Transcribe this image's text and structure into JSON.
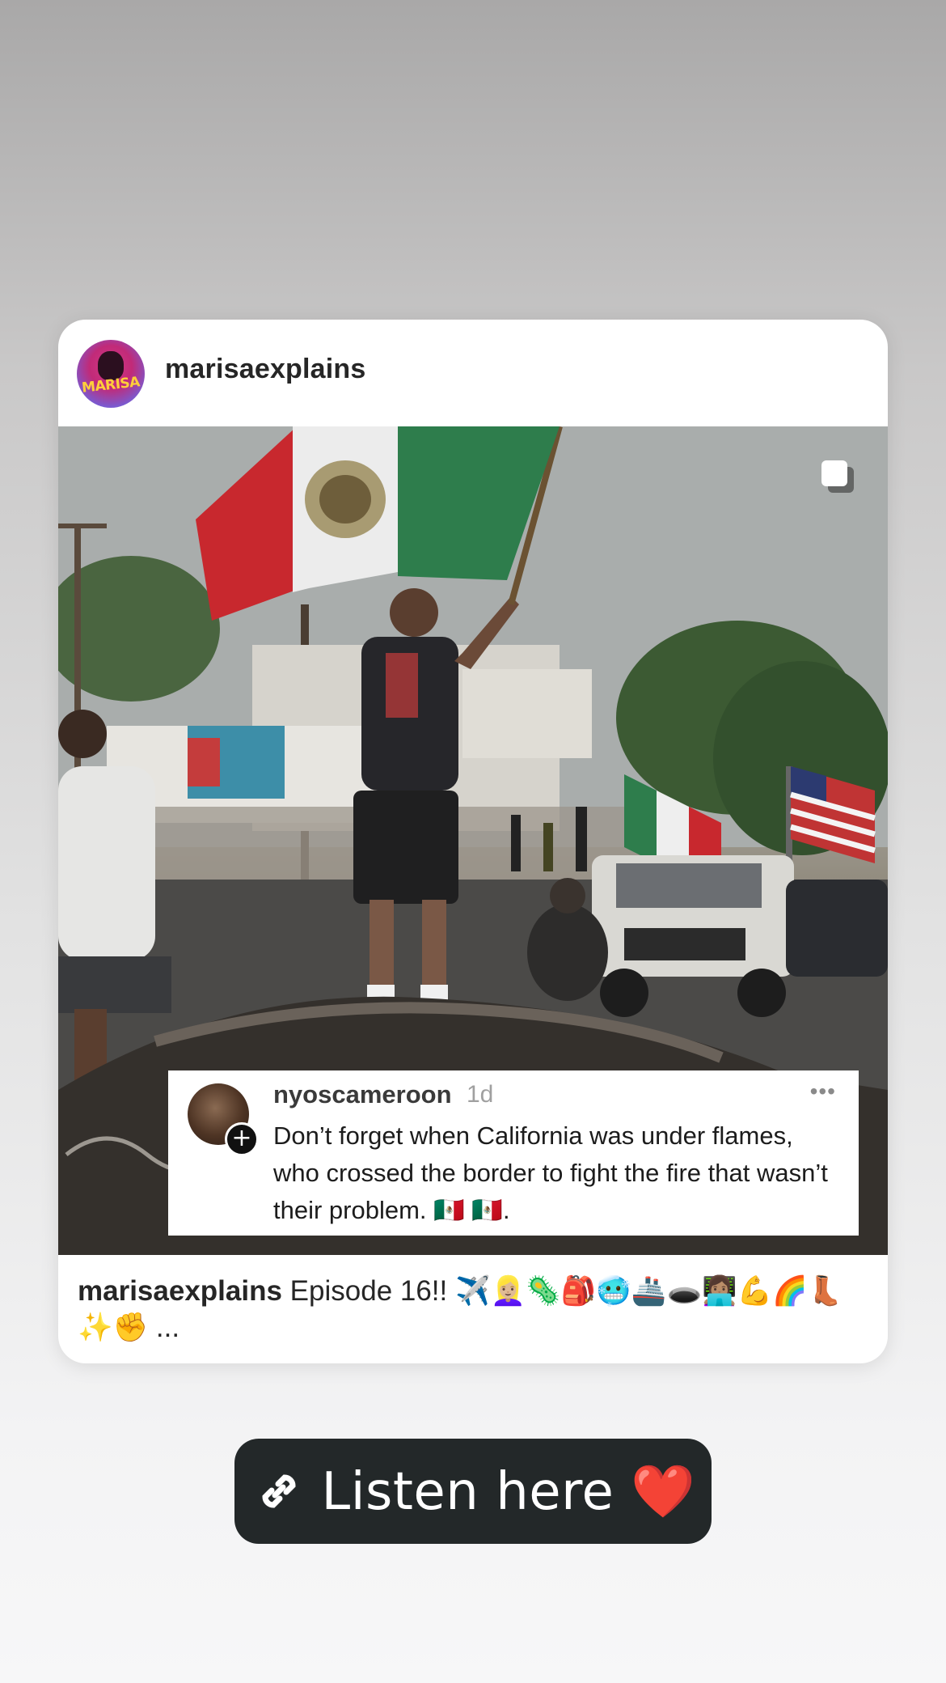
{
  "post": {
    "username": "marisaexplains",
    "avatar_text": "MARISA",
    "comment": {
      "username": "nyoscameroon",
      "time": "1d",
      "more": "•••",
      "text": "Don’t forget when California was under flames, who crossed the border to fight the fire that wasn’t their problem. 🇲🇽 🇲🇽."
    },
    "caption": {
      "username": "marisaexplains",
      "text": "Episode 16!! ✈️👱🏼‍♀️🦠🎒🥶🚢🕳️👩🏽‍💻💪🌈👢✨✊ ..."
    }
  },
  "link_sticker": {
    "label": "Listen here ❤️",
    "icon": "link-icon"
  },
  "colors": {
    "sticker_bg": "#232829",
    "flag_green": "#2e7d4c",
    "flag_red": "#c8282e"
  }
}
